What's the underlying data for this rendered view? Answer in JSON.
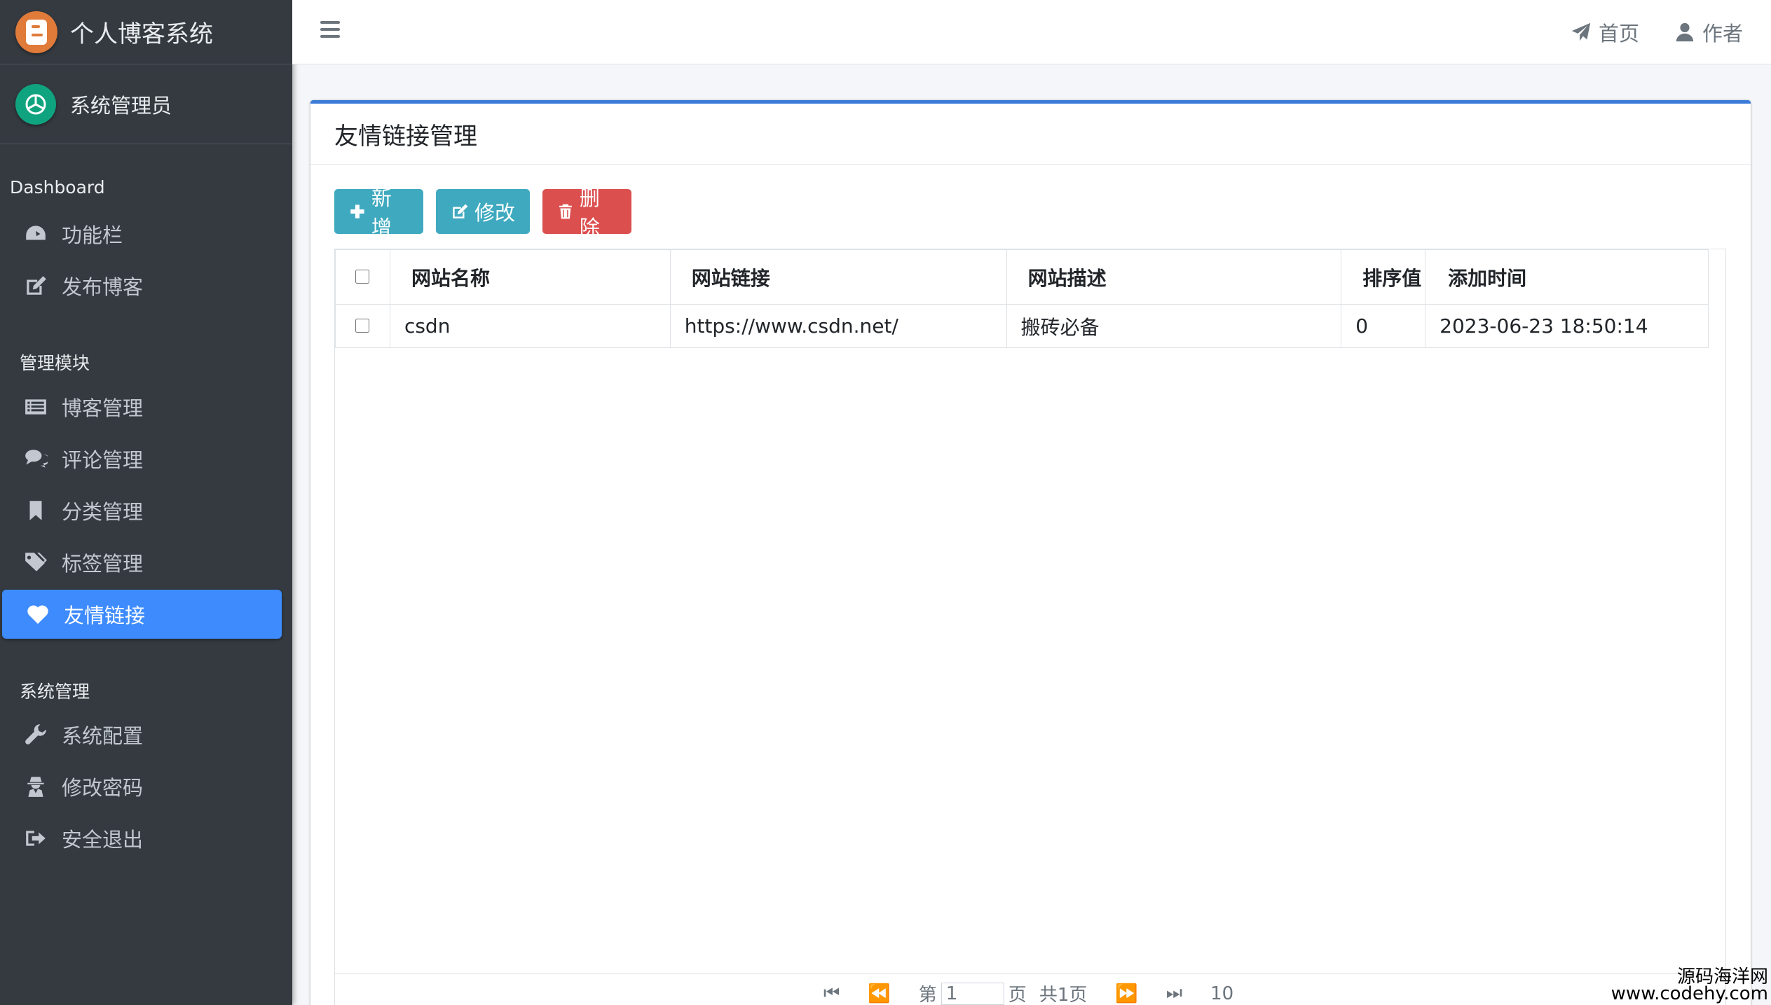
{
  "brand": {
    "title": "个人博客系统"
  },
  "user": {
    "name": "系统管理员"
  },
  "sidebar": {
    "sections": [
      {
        "header": "Dashboard",
        "items": [
          {
            "label": "功能栏",
            "icon": "dashboard-icon"
          },
          {
            "label": "发布博客",
            "icon": "edit-icon"
          }
        ]
      },
      {
        "header": "管理模块",
        "items": [
          {
            "label": "博客管理",
            "icon": "list-icon"
          },
          {
            "label": "评论管理",
            "icon": "comments-icon"
          },
          {
            "label": "分类管理",
            "icon": "bookmark-icon"
          },
          {
            "label": "标签管理",
            "icon": "tags-icon"
          },
          {
            "label": "友情链接",
            "icon": "heart-icon",
            "active": true
          }
        ]
      },
      {
        "header": "系统管理",
        "items": [
          {
            "label": "系统配置",
            "icon": "wrench-icon"
          },
          {
            "label": "修改密码",
            "icon": "user-secret-icon"
          },
          {
            "label": "安全退出",
            "icon": "sign-out-icon"
          }
        ]
      }
    ]
  },
  "topbar": {
    "home_label": "首页",
    "author_label": "作者"
  },
  "card": {
    "title": "友情链接管理"
  },
  "toolbar": {
    "add_label": "新增",
    "edit_label": "修改",
    "delete_label": "删除"
  },
  "table": {
    "columns": [
      "网站名称",
      "网站链接",
      "网站描述",
      "排序值",
      "添加时间"
    ],
    "rows": [
      {
        "name": "csdn",
        "url": "https://www.csdn.net/",
        "desc": "搬砖必备",
        "order": "0",
        "time": "2023-06-23 18:50:14"
      }
    ]
  },
  "pager": {
    "page_prefix": "第",
    "page_value": "1",
    "page_suffix": "页",
    "total": "共1页",
    "page_size": "10"
  },
  "watermark": {
    "line1": "源码海洋网",
    "line2": "www.codehy.com"
  },
  "colors": {
    "sidebar_bg": "#343a40",
    "active_item": "#3d8bfd",
    "card_border": "#3d7bd9",
    "info_button": "#3fa9bf",
    "danger_button": "#dc4f4f"
  }
}
